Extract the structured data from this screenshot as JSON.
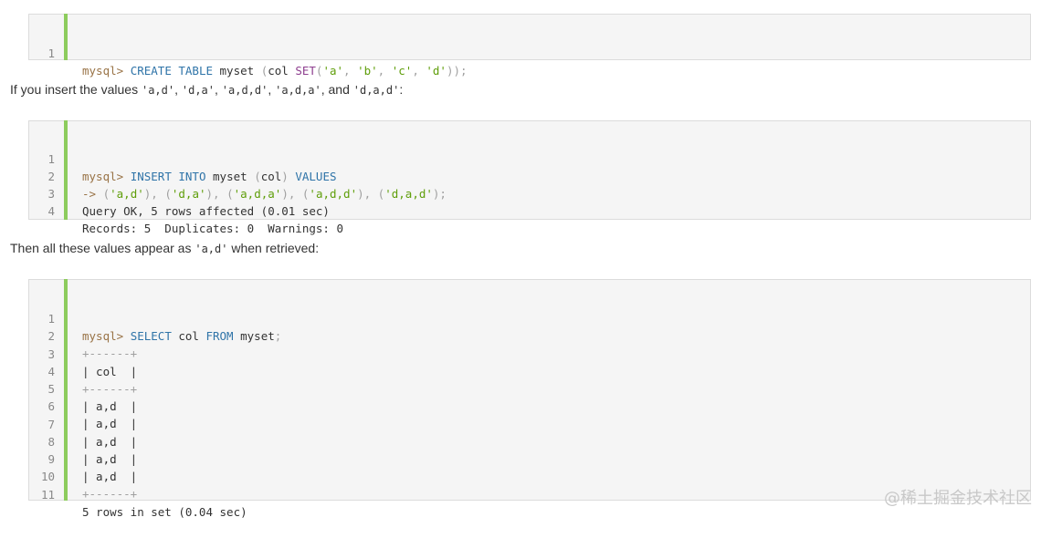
{
  "block1": {
    "lines": [
      {
        "n": "1",
        "prompt": "mysql>",
        "a": "CREATE TABLE",
        "b": "myset",
        "c": "(",
        "d": "col",
        "e": "SET",
        "f": "(",
        "s1": "'a'",
        "g": ", ",
        "s2": "'b'",
        "h": ", ",
        "s3": "'c'",
        "i": ", ",
        "s4": "'d'",
        "j": "));"
      }
    ]
  },
  "prose1": {
    "before": "If you insert the values ",
    "v1": "'a,d'",
    "sep1": ", ",
    "v2": "'d,a'",
    "sep2": ", ",
    "v3": "'a,d,d'",
    "sep3": ", ",
    "v4": "'a,d,a'",
    "sep4": ", and ",
    "v5": "'d,a,d'",
    "after": ":"
  },
  "block2": {
    "l1": {
      "n": "1",
      "prompt": "mysql>",
      "kw1": "INSERT INTO",
      "t": "myset",
      "p1": "(",
      "c": "col",
      "p2": ")",
      "kw2": "VALUES"
    },
    "l2": {
      "n": "2",
      "arrow": "->",
      "p": "(",
      "s1": "'a,d'",
      "q1": "), (",
      "s2": "'d,a'",
      "q2": "), (",
      "s3": "'a,d,a'",
      "q3": "), (",
      "s4": "'a,d,d'",
      "q4": "), (",
      "s5": "'d,a,d'",
      "q5": ");"
    },
    "l3": {
      "n": "3",
      "text": "Query OK, 5 rows affected (0.01 sec)"
    },
    "l4": {
      "n": "4",
      "text": "Records: 5  Duplicates: 0  Warnings: 0"
    }
  },
  "prose2": {
    "before": "Then all these values appear as ",
    "v": "'a,d'",
    "after": " when retrieved:"
  },
  "block3": {
    "l1": {
      "n": "1",
      "prompt": "mysql>",
      "kw1": "SELECT",
      "c": "col",
      "kw2": "FROM",
      "t": "myset",
      "semi": ";"
    },
    "l2": {
      "n": "2",
      "text": "+------+"
    },
    "l3": {
      "n": "3",
      "text": "| col  |"
    },
    "l4": {
      "n": "4",
      "text": "+------+"
    },
    "l5": {
      "n": "5",
      "text": "| a,d  |"
    },
    "l6": {
      "n": "6",
      "text": "| a,d  |"
    },
    "l7": {
      "n": "7",
      "text": "| a,d  |"
    },
    "l8": {
      "n": "8",
      "text": "| a,d  |"
    },
    "l9": {
      "n": "9",
      "text": "| a,d  |"
    },
    "l10": {
      "n": "10",
      "text": "+------+"
    },
    "l11": {
      "n": "11",
      "text": "5 rows in set (0.04 sec)"
    }
  },
  "watermark": "@稀土掘金技术社区",
  "colors": {
    "accent_bar": "#8dcc5d",
    "keyword": "#2f74a8",
    "string": "#5f9e0a",
    "prompt": "#997346",
    "function": "#8e3f8f"
  }
}
